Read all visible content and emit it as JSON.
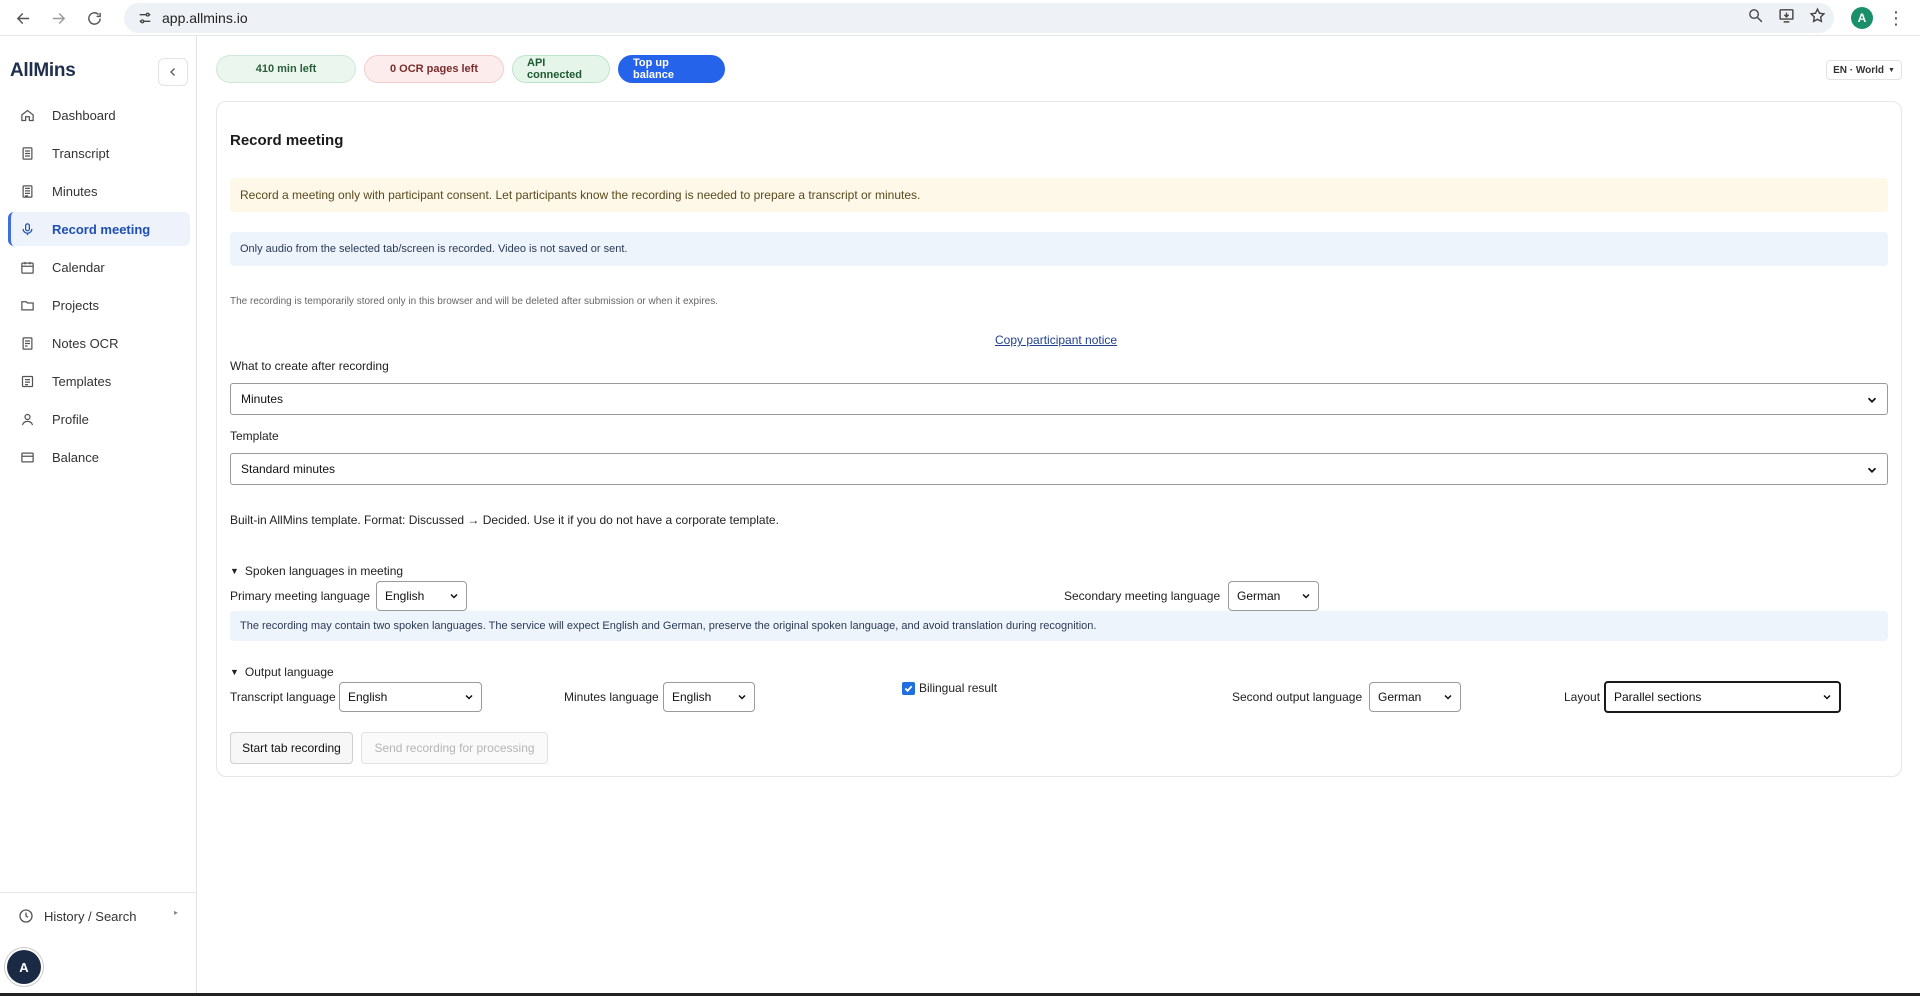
{
  "browser": {
    "url": "app.allmins.io",
    "profile_initial": "A"
  },
  "sidebar": {
    "brand": "AllMins",
    "items": [
      {
        "label": "Dashboard",
        "icon": "home-icon"
      },
      {
        "label": "Transcript",
        "icon": "document-icon"
      },
      {
        "label": "Minutes",
        "icon": "list-document-icon"
      },
      {
        "label": "Record meeting",
        "icon": "microphone-icon",
        "active": true
      },
      {
        "label": "Calendar",
        "icon": "calendar-icon"
      },
      {
        "label": "Projects",
        "icon": "folder-icon"
      },
      {
        "label": "Notes OCR",
        "icon": "scan-document-icon"
      },
      {
        "label": "Templates",
        "icon": "template-icon"
      },
      {
        "label": "Profile",
        "icon": "user-icon"
      },
      {
        "label": "Balance",
        "icon": "card-icon"
      }
    ],
    "history_label": "History / Search",
    "user_initial": "A"
  },
  "topbar": {
    "minutes_left": "410 min left",
    "ocr_left": "0 OCR pages left",
    "api_status": "API connected",
    "top_up": "Top up balance",
    "locale": "EN · World"
  },
  "main": {
    "title": "Record meeting",
    "consent_notice": "Record a meeting only with participant consent. Let participants know the recording is needed to prepare a transcript or minutes.",
    "audio_notice": "Only audio from the selected tab/screen is recorded. Video is not saved or sent.",
    "storage_note": "The recording is temporarily stored only in this browser and will be deleted after submission or when it expires.",
    "copy_notice_link": "Copy participant notice",
    "create_label": "What to create after recording",
    "create_value": "Minutes",
    "template_label": "Template",
    "template_value": "Standard minutes",
    "template_help": "Built-in AllMins template. Format: Discussed → Decided. Use it if you do not have a corporate template.",
    "spoken_section": "Spoken languages in meeting",
    "primary_label": "Primary meeting language",
    "primary_value": "English",
    "secondary_label": "Secondary meeting language",
    "secondary_value": "German",
    "bilingual_info": "The recording may contain two spoken languages. The service will expect English and German, preserve the original spoken language, and avoid translation during recognition.",
    "output_section": "Output language",
    "transcript_label": "Transcript language",
    "transcript_value": "English",
    "minutes_lang_label": "Minutes language",
    "minutes_lang_value": "English",
    "bilingual_label": "Bilingual result",
    "bilingual_checked": true,
    "second_output_label": "Second output language",
    "second_output_value": "German",
    "layout_label": "Layout",
    "layout_value": "Parallel sections",
    "start_button": "Start tab recording",
    "send_button": "Send recording for processing"
  }
}
